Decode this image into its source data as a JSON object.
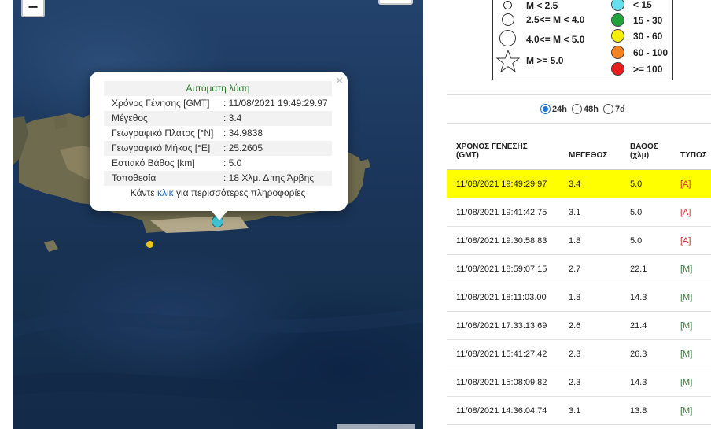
{
  "map": {
    "zoom_out_label": "−",
    "popup": {
      "close_label": "×",
      "title": "Αυτόματη λύση",
      "rows": [
        {
          "key": "Χρόνος Γένησης [GMT]",
          "value": ": 11/08/2021 19:49:29.97"
        },
        {
          "key": "Μέγεθος",
          "value": ": 3.4"
        },
        {
          "key": "Γεωγραφικό Πλάτος [°N]",
          "value": ": 34.9838"
        },
        {
          "key": "Γεωγραφικό Μήκος [°E]",
          "value": ": 25.2605"
        },
        {
          "key": "Εστιακό Βάθος [km]",
          "value": ": 5.0"
        },
        {
          "key": "Τοποθεσία",
          "value": ": 18 Χλμ. Δ της Άρβης"
        }
      ],
      "footer_pre": "Κάντε ",
      "footer_link": "κλικ",
      "footer_post": " για περισσότερες πληροφορίες"
    },
    "colors": {
      "selected_quake": "#3fc5d6",
      "other_quake": "#f0c419"
    }
  },
  "legend": {
    "magnitude": [
      {
        "label": "M < 2.5"
      },
      {
        "label": "2.5<= M < 4.0"
      },
      {
        "label": "4.0<= M < 5.0"
      },
      {
        "label": "M >= 5.0"
      }
    ],
    "depth": [
      {
        "label": "< 15",
        "color": "#66e0ee"
      },
      {
        "label": "15 - 30",
        "color": "#22a33a"
      },
      {
        "label": "30 - 60",
        "color": "#f5ee00"
      },
      {
        "label": "60 - 100",
        "color": "#f5821f"
      },
      {
        "label": ">= 100",
        "color": "#e81c1c"
      }
    ]
  },
  "time_filter": {
    "options": [
      {
        "label": "24h",
        "selected": true
      },
      {
        "label": "48h",
        "selected": false
      },
      {
        "label": "7d",
        "selected": false
      }
    ]
  },
  "table": {
    "headers": {
      "time_l1": "ΧΡΟΝΟΣ ΓΕΝΕΣΗΣ",
      "time_l2": "(GMT)",
      "magnitude": "ΜΕΓΕΘΟΣ",
      "depth_l1": "ΒΑΘΟΣ",
      "depth_l2": "(χλμ)",
      "type": "ΤΥΠΟΣ"
    },
    "rows": [
      {
        "time": "11/08/2021 19:49:29.97",
        "magnitude": "3.4",
        "depth": "5.0",
        "type": "[A]",
        "highlight": true
      },
      {
        "time": "11/08/2021 19:41:42.75",
        "magnitude": "3.1",
        "depth": "5.0",
        "type": "[A]"
      },
      {
        "time": "11/08/2021 19:30:58.83",
        "magnitude": "1.8",
        "depth": "5.0",
        "type": "[A]"
      },
      {
        "time": "11/08/2021 18:59:07.15",
        "magnitude": "2.7",
        "depth": "22.1",
        "type": "[M]"
      },
      {
        "time": "11/08/2021 18:11:03.00",
        "magnitude": "1.8",
        "depth": "14.3",
        "type": "[M]"
      },
      {
        "time": "11/08/2021 17:33:13.69",
        "magnitude": "2.6",
        "depth": "21.4",
        "type": "[M]"
      },
      {
        "time": "11/08/2021 15:41:27.42",
        "magnitude": "2.3",
        "depth": "26.3",
        "type": "[M]"
      },
      {
        "time": "11/08/2021 15:08:09.82",
        "magnitude": "2.3",
        "depth": "14.3",
        "type": "[M]"
      },
      {
        "time": "11/08/2021 14:36:04.74",
        "magnitude": "3.1",
        "depth": "13.8",
        "type": "[M]"
      }
    ],
    "highlight_color": "#ffff00"
  }
}
